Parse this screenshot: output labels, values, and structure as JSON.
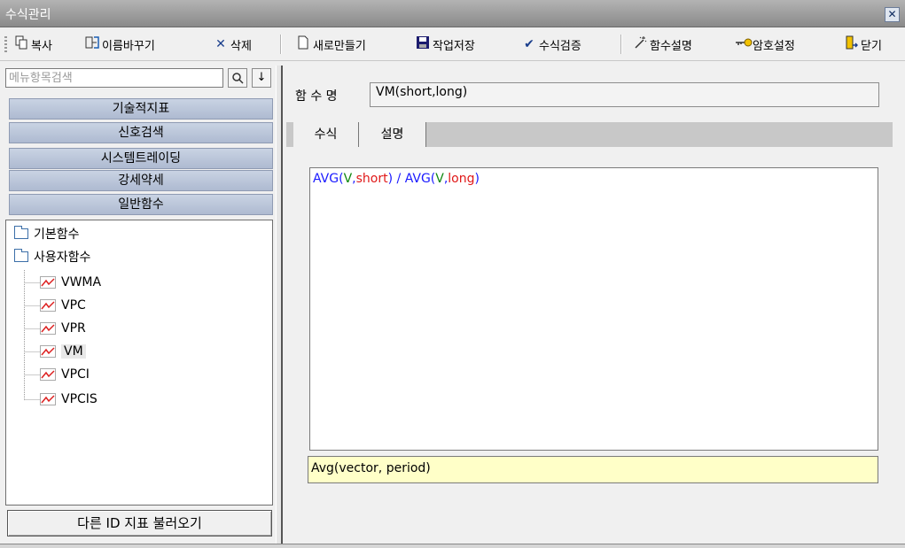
{
  "window": {
    "title": "수식관리",
    "close": "✕"
  },
  "toolbar": {
    "copy": "복사",
    "rename": "이름바꾸기",
    "delete": "삭제",
    "new": "새로만들기",
    "save": "작업저장",
    "verify": "수식검증",
    "func_desc": "함수설명",
    "password": "암호설정",
    "close": "닫기"
  },
  "search": {
    "placeholder": "메뉴항목검색",
    "value": ""
  },
  "menu": [
    "기술적지표",
    "신호검색",
    "시스템트레이딩",
    "강세약세",
    "일반함수"
  ],
  "tree": {
    "folders": [
      "기본함수",
      "사용자함수"
    ],
    "items": [
      "VWMA",
      "VPC",
      "VPR",
      "VM",
      "VPCI",
      "VPCIS"
    ],
    "selected": "VM"
  },
  "load_button": "다른 ID 지표 불러오기",
  "function_name": {
    "label": "함 수 명",
    "value": "VM(short,long)"
  },
  "tabs": [
    "수식",
    "설명"
  ],
  "formula": {
    "tokens": [
      {
        "t": "AVG(",
        "c": "blue"
      },
      {
        "t": "V",
        "c": "green"
      },
      {
        "t": ",",
        "c": "blue"
      },
      {
        "t": "short",
        "c": "red"
      },
      {
        "t": ") / ",
        "c": "blue"
      },
      {
        "t": "AVG(",
        "c": "blue"
      },
      {
        "t": "V",
        "c": "green"
      },
      {
        "t": ",",
        "c": "blue"
      },
      {
        "t": "long",
        "c": "red"
      },
      {
        "t": ")",
        "c": "blue"
      }
    ]
  },
  "hint": "Avg(vector, period)"
}
